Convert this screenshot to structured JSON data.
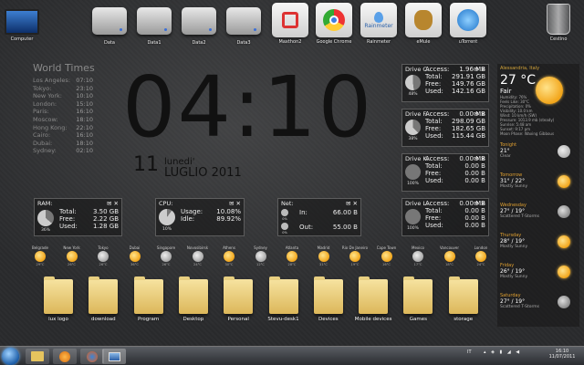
{
  "desktop_icons": [
    {
      "label": "Computer",
      "icon": "computer-icon"
    },
    {
      "label": "Data",
      "icon": "drive-icon"
    },
    {
      "label": "Data1",
      "icon": "drive-icon"
    },
    {
      "label": "Data2",
      "icon": "drive-icon"
    },
    {
      "label": "Data3",
      "icon": "drive-icon"
    },
    {
      "label": "Maxthon2",
      "icon": "maxthon-icon"
    },
    {
      "label": "Google Chrome",
      "icon": "chrome-icon"
    },
    {
      "label": "Rainmeter",
      "icon": "rainmeter-icon"
    },
    {
      "label": "eMule",
      "icon": "emule-icon"
    },
    {
      "label": "uTorrent",
      "icon": "utorrent-icon"
    },
    {
      "label": "Cestino",
      "icon": "recycle-bin-icon"
    }
  ],
  "rainmeter_badge": "Rainmeter",
  "world_times": {
    "title": "World Times",
    "rows": [
      {
        "city": "Los Angeles:",
        "time": "07:10"
      },
      {
        "city": "Tokyo:",
        "time": "23:10"
      },
      {
        "city": "New York:",
        "time": "10:10"
      },
      {
        "city": "London:",
        "time": "15:10"
      },
      {
        "city": "Paris:",
        "time": "16:10"
      },
      {
        "city": "Moscow:",
        "time": "18:10"
      },
      {
        "city": "Hong Kong:",
        "time": "22:10"
      },
      {
        "city": "Cairo:",
        "time": "16:10"
      },
      {
        "city": "Dubai:",
        "time": "18:10"
      },
      {
        "city": "Sydney:",
        "time": "02:10"
      }
    ]
  },
  "clock": {
    "time": "04:10",
    "day_num": "11",
    "weekday": "lunedi'",
    "month_year": "LUGLIO 2011"
  },
  "ram": {
    "title": "RAM:",
    "pct": "36%",
    "total_label": "Total:",
    "total": "3.50 GB",
    "free_label": "Free:",
    "free": "2.22 GB",
    "used_label": "Used:",
    "used": "1.28 GB"
  },
  "cpu": {
    "title": "CPU:",
    "pct": "10%",
    "usage_label": "Usage:",
    "usage": "10.08%",
    "idle_label": "Idle:",
    "idle": "89.92%"
  },
  "net": {
    "title": "Net:",
    "in_pct": "0%",
    "out_pct": "0%",
    "in_label": "In:",
    "in": "66.00 B",
    "out_label": "Out:",
    "out": "55.00 B"
  },
  "drives": [
    {
      "title": "Drive",
      "letter": "C:",
      "pct": "48%",
      "access_label": "Access:",
      "access": "1.96 MB",
      "total_label": "Total:",
      "total": "291.91 GB",
      "free_label": "Free:",
      "free": "149.76 GB",
      "used_label": "Used:",
      "used": "142.16 GB"
    },
    {
      "title": "Drive",
      "letter": "F:",
      "pct": "38%",
      "access_label": "Access:",
      "access": "0.00 MB",
      "total_label": "Total:",
      "total": "298.09 GB",
      "free_label": "Free:",
      "free": "182.65 GB",
      "used_label": "Used:",
      "used": "115.44 GB"
    },
    {
      "title": "Drive",
      "letter": "K:",
      "pct": "100%",
      "access_label": "Access:",
      "access": "0.00 MB",
      "total_label": "Total:",
      "total": "0.00 B",
      "free_label": "Free:",
      "free": "0.00 B",
      "used_label": "Used:",
      "used": "0.00 B"
    },
    {
      "title": "Drive",
      "letter": "L:",
      "pct": "100%",
      "access_label": "Access:",
      "access": "0.00 MB",
      "total_label": "Total:",
      "total": "0.00 B",
      "free_label": "Free:",
      "free": "0.00 B",
      "used_label": "Used:",
      "used": "0.00 B"
    }
  ],
  "weather": {
    "location": "Alessandria, Italy",
    "temp": "27 °C",
    "condition": "Fair",
    "details": [
      "Humidity: 76%",
      "Feels Like: 30°C",
      "Precipitation: 0%",
      "Visibility: 10.0 km",
      "Wind: 10 km/h (SW)",
      "Pressure: 1013.9 mb (steady)",
      "Sunrise: 5:48 am",
      "Sunset: 9:17 pm",
      "Moon Phase: Waxing Gibbous"
    ],
    "forecast": [
      {
        "day": "Tonight",
        "temp": "21°",
        "cond": "Clear"
      },
      {
        "day": "Tomorrow",
        "temp": "31° / 22°",
        "cond": "Mostly Sunny"
      },
      {
        "day": "Wednesday",
        "temp": "27° / 19°",
        "cond": "Scattered T-Storms"
      },
      {
        "day": "Thursday",
        "temp": "28° / 19°",
        "cond": "Mostly Sunny"
      },
      {
        "day": "Friday",
        "temp": "26° / 19°",
        "cond": "Mostly Sunny"
      },
      {
        "day": "Saturday",
        "temp": "27° / 19°",
        "cond": "Scattered T-Storms"
      }
    ]
  },
  "city_weather": [
    {
      "city": "Belgrade",
      "v": "29°C"
    },
    {
      "city": "New York",
      "v": "26°C"
    },
    {
      "city": "Tokyo",
      "v": "26°C"
    },
    {
      "city": "Dubai",
      "v": "36°C"
    },
    {
      "city": "Singapore",
      "v": "26°C"
    },
    {
      "city": "Novosibirsk",
      "v": "24°C"
    },
    {
      "city": "Athens",
      "v": "30°C"
    },
    {
      "city": "Sydney",
      "v": "12°C"
    },
    {
      "city": "Atlanta",
      "v": "28°C"
    },
    {
      "city": "Madrid",
      "v": "31°C"
    },
    {
      "city": "Rio De Janeiro",
      "v": "19°C"
    },
    {
      "city": "Cape Town",
      "v": "16°C"
    },
    {
      "city": "Mexico",
      "v": "17°C"
    },
    {
      "city": "Vancouver",
      "v": "18°C"
    },
    {
      "city": "London",
      "v": "24°C"
    }
  ],
  "folders": [
    "lux logo",
    "download",
    "Program",
    "Desktop",
    "Personal",
    "Stevu-desk1",
    "Devices",
    "Mobile devices",
    "Games",
    "storage"
  ],
  "taskbar": {
    "lang": "IT",
    "time": "16:10",
    "date": "11/07/2011"
  }
}
